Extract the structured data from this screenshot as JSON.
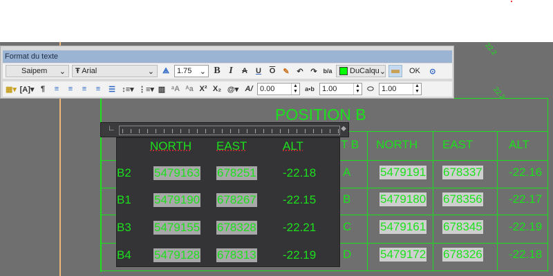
{
  "toolbar": {
    "title": "Format du texte",
    "style": "Saipem",
    "font": "Arial",
    "height": "1.75",
    "color_label": "DuCalqu",
    "color": "#00ff00",
    "ok": "OK",
    "oblique": "0.00",
    "tracking": "1.00",
    "width_factor": "1.00",
    "superscript": "X²",
    "subscript": "X₂",
    "symbol": "@"
  },
  "drawing": {
    "title": "POSITION B",
    "left_header": [
      "NORTH",
      "EAST",
      "ALT"
    ],
    "left_rows": [
      {
        "id": "B2",
        "north": "5479163",
        "east": "678251",
        "alt": "-22.18"
      },
      {
        "id": "B1",
        "north": "5479190",
        "east": "678267",
        "alt": "-22.15"
      },
      {
        "id": "B3",
        "north": "5479155",
        "east": "678328",
        "alt": "-22.21"
      },
      {
        "id": "B4",
        "north": "5479128",
        "east": "678313",
        "alt": "-22.19"
      }
    ],
    "right_header": [
      "T B",
      "NORTH",
      "EAST",
      "ALT"
    ],
    "right_rows": [
      {
        "id": "A",
        "north": "5479191",
        "east": "678337",
        "alt": "-22.16"
      },
      {
        "id": "B",
        "north": "5479180",
        "east": "678356",
        "alt": "-22.17"
      },
      {
        "id": "C",
        "north": "5479161",
        "east": "678345",
        "alt": "-22.19"
      },
      {
        "id": "D",
        "north": "5479172",
        "east": "678326",
        "alt": "-22.18"
      }
    ],
    "contour_labels": [
      "22.2",
      "22.2"
    ]
  },
  "colors": {
    "cad_text": "#1de01d",
    "canvas": "#6f6f6f",
    "titlebar": "#9bb4d3"
  }
}
